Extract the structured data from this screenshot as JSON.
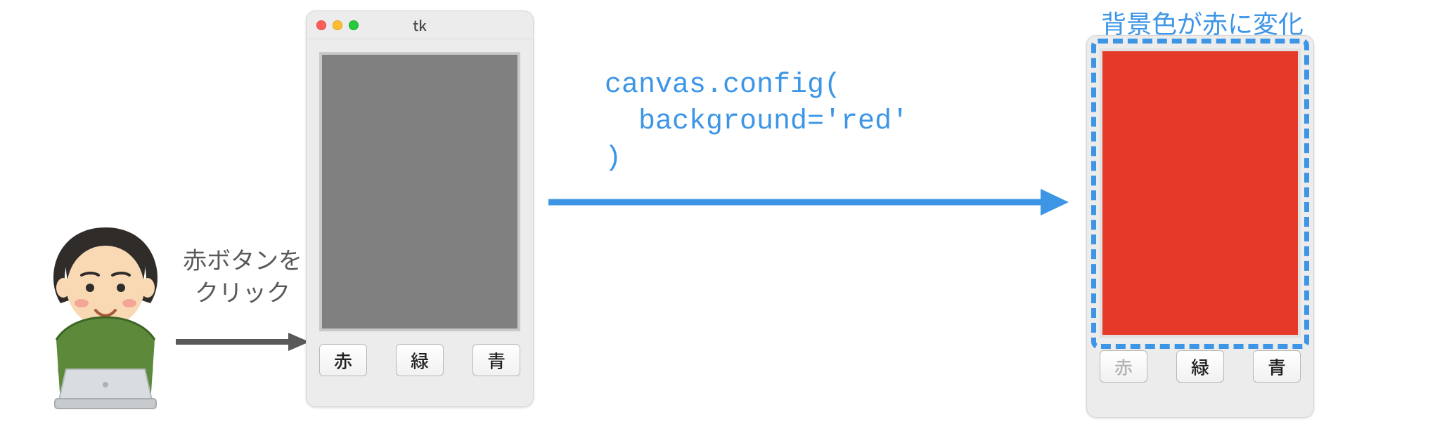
{
  "caption_click_line1": "赤ボタンを",
  "caption_click_line2": "クリック",
  "window_left": {
    "title": "tk",
    "canvas_bg": "#808080",
    "buttons": {
      "red": "赤",
      "green": "緑",
      "blue": "青"
    }
  },
  "code_snippet": "canvas.config(\n  background='red'\n)",
  "window_right": {
    "canvas_bg": "#e53a29",
    "buttons": {
      "red": "赤",
      "green": "緑",
      "blue": "青"
    }
  },
  "caption_result": "背景色が赤に変化",
  "colors": {
    "arrow_grey": "#595959",
    "arrow_blue": "#3d95e6",
    "highlight_blue": "#3d95e6"
  }
}
